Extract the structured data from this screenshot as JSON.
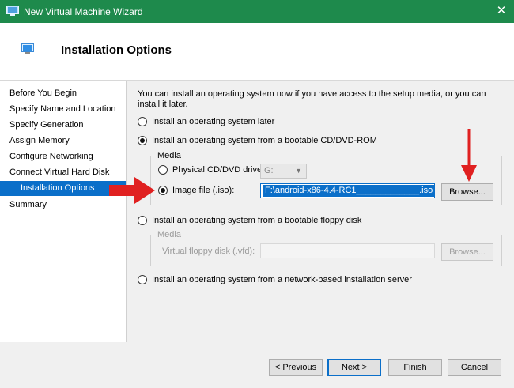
{
  "window": {
    "title": "New Virtual Machine Wizard",
    "close_glyph": "✕",
    "accent_color": "#1e8a4c"
  },
  "header": {
    "title": "Installation Options",
    "icon": "monitor-icon"
  },
  "nav": {
    "items": [
      {
        "label": "Before You Begin"
      },
      {
        "label": "Specify Name and Location"
      },
      {
        "label": "Specify Generation"
      },
      {
        "label": "Assign Memory"
      },
      {
        "label": "Configure Networking"
      },
      {
        "label": "Connect Virtual Hard Disk"
      },
      {
        "label": "Installation Options",
        "active": true
      },
      {
        "label": "Summary"
      }
    ]
  },
  "main": {
    "intro": "You can install an operating system now if you have access to the setup media, or you can install it later.",
    "option_later": "Install an operating system later",
    "option_dvd": "Install an operating system from a bootable CD/DVD-ROM",
    "media_group_label": "Media",
    "physical_drive_label": "Physical CD/DVD drive:",
    "physical_drive_value": "G:",
    "image_file_label": "Image file (.iso):",
    "image_file_value": "F:\\android-x86-4.4-RC1_____________.iso",
    "browse_label": "Browse...",
    "option_floppy": "Install an operating system from a bootable floppy disk",
    "floppy_media_label": "Media",
    "floppy_disk_label": "Virtual floppy disk (.vfd):",
    "floppy_browse_label": "Browse...",
    "option_network": "Install an operating system from a network-based installation server"
  },
  "footer": {
    "previous_label": "< Previous",
    "next_label": "Next >",
    "finish_label": "Finish",
    "cancel_label": "Cancel"
  },
  "annotations": {
    "arrow_color": "#e02020"
  }
}
